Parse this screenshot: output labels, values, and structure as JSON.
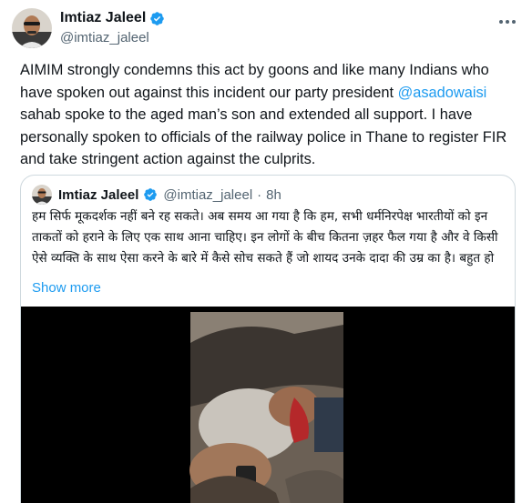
{
  "author": {
    "name": "Imtiaz Jaleel",
    "handle": "@imtiaz_jaleel",
    "verified_icon": "verified-badge-icon",
    "more_icon": "more-horizontal-icon"
  },
  "tweet": {
    "text_before_mention": "AIMIM strongly condemns this act by goons and like many Indians who have spoken out against this incident our party president ",
    "mention": "@asadowaisi",
    "text_after_mention": " sahab spoke to the aged man’s son and extended all support. I have personally spoken to officials of the railway police in Thane to register FIR and take stringent action against the culprits."
  },
  "quoted_tweet": {
    "name": "Imtiaz Jaleel",
    "handle": "@imtiaz_jaleel",
    "separator": "·",
    "time": "8h",
    "text": "हम सिर्फ मूकदर्शक नहीं बने रह सकते। अब समय आ गया है कि हम, सभी धर्मनिरपेक्ष भारतीयों को इन ताकतों को हराने के लिए एक साथ आना चाहिए। इन लोगों के बीच कितना ज़हर फैल गया है और वे किसी ऐसे व्यक्ति के साथ ऐसा करने के बारे में कैसे सोच सकते हैं जो शायद उनके दादा की उम्र का है। बहुत हो",
    "show_more": "Show more",
    "media": "video-thumbnail"
  },
  "colors": {
    "text": "#0f1419",
    "secondary": "#536471",
    "accent": "#1d9bf0",
    "border": "#cfd9de"
  }
}
